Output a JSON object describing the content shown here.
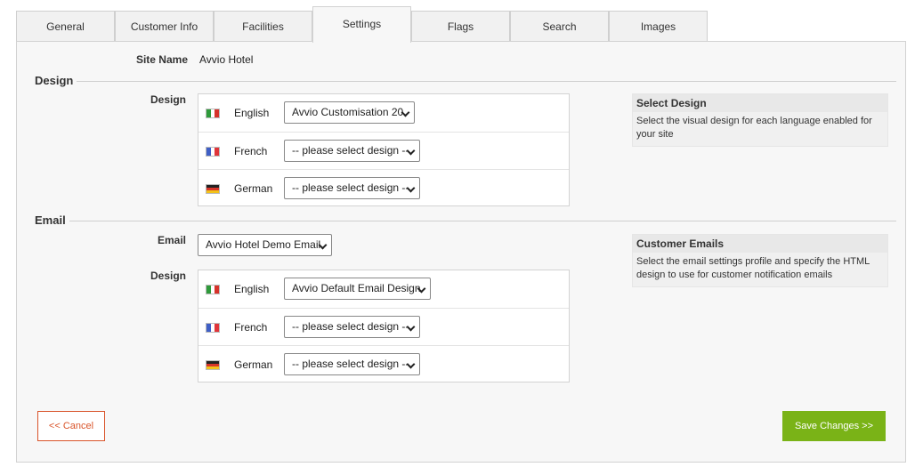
{
  "tabs": [
    {
      "label": "General"
    },
    {
      "label": "Customer Info"
    },
    {
      "label": "Facilities"
    },
    {
      "label": "Settings"
    },
    {
      "label": "Flags"
    },
    {
      "label": "Search"
    },
    {
      "label": "Images"
    }
  ],
  "active_tab": "Settings",
  "site_name": {
    "label": "Site Name",
    "value": "Avvio Hotel"
  },
  "design_section": {
    "title": "Design",
    "field_label": "Design",
    "languages": [
      {
        "name": "English",
        "flag": "italy-flag-icon",
        "selected": "Avvio Customisation 20"
      },
      {
        "name": "French",
        "flag": "france-flag-icon",
        "selected": "-- please select design --"
      },
      {
        "name": "German",
        "flag": "germany-flag-icon",
        "selected": "-- please select design --"
      }
    ],
    "help": {
      "title": "Select Design",
      "text": "Select the visual design for each language enabled for your site"
    }
  },
  "email_section": {
    "title": "Email",
    "email_label": "Email",
    "email_selected": "Avvio Hotel Demo Email",
    "design_label": "Design",
    "languages": [
      {
        "name": "English",
        "flag": "italy-flag-icon",
        "selected": "Avvio Default Email Design"
      },
      {
        "name": "French",
        "flag": "france-flag-icon",
        "selected": "-- please select design --"
      },
      {
        "name": "German",
        "flag": "germany-flag-icon",
        "selected": "-- please select design --"
      }
    ],
    "help": {
      "title": "Customer Emails",
      "text": "Select the email settings profile and specify the HTML design to use for customer notification emails"
    }
  },
  "buttons": {
    "cancel": "<< Cancel",
    "save": "Save Changes >>"
  },
  "colors": {
    "save_button": "#7ab317",
    "cancel_border": "#d9542a"
  }
}
